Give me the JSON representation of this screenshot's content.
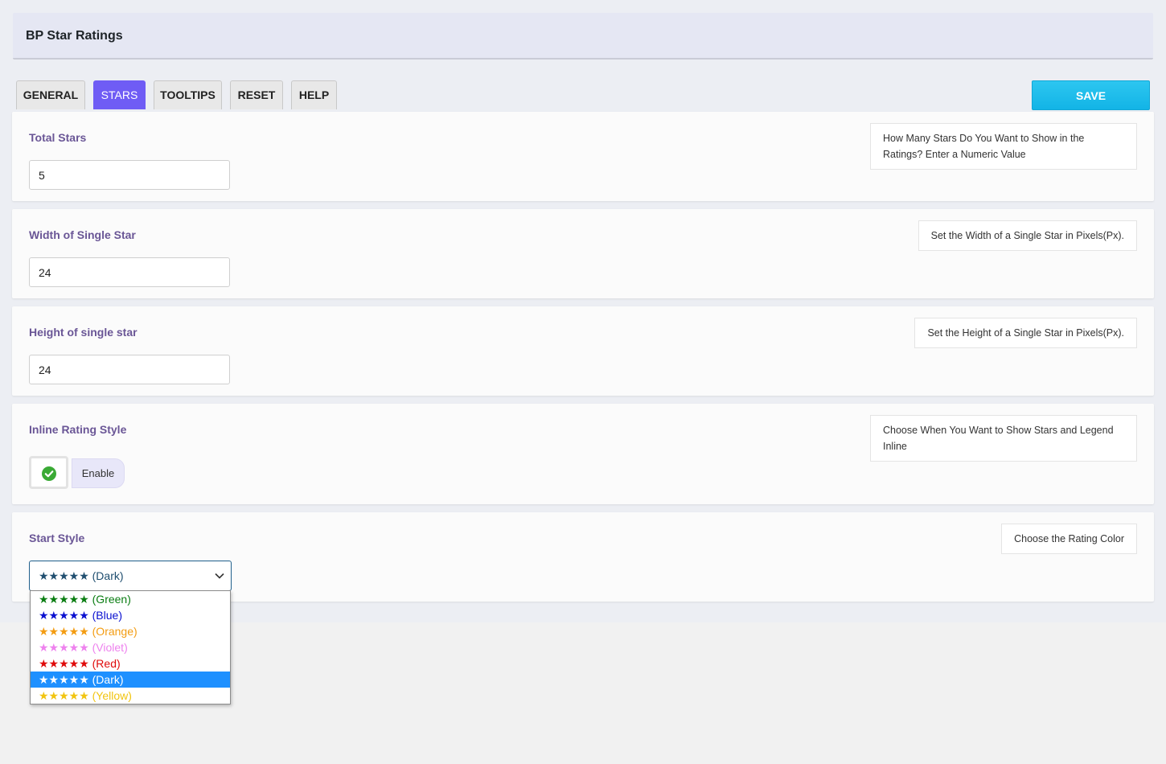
{
  "header": {
    "title": "BP Star Ratings"
  },
  "tabs": [
    {
      "label": "GENERAL"
    },
    {
      "label": "STARS"
    },
    {
      "label": "TOOLTIPS"
    },
    {
      "label": "RESET"
    },
    {
      "label": "HELP"
    }
  ],
  "active_tab": "STARS",
  "save_label": "SAVE",
  "fields": {
    "total_stars": {
      "label": "Total Stars",
      "value": "5",
      "help": "How Many Stars Do You Want to Show in the Ratings? Enter a Numeric Value"
    },
    "star_width": {
      "label": "Width of Single Star",
      "value": "24",
      "help": "Set the Width of a Single Star in Pixels(Px)."
    },
    "star_height": {
      "label": "Height of single star",
      "value": "24",
      "help": "Set the Height of a Single Star in Pixels(Px)."
    },
    "inline_style": {
      "label": "Inline Rating Style",
      "toggle_label": "Enable",
      "enabled": true,
      "help": "Choose When You Want to Show Stars and Legend Inline"
    },
    "star_style": {
      "label": "Start Style",
      "selected": "★★★★★ (Dark)",
      "help": "Choose the Rating Color",
      "options": [
        {
          "label": "★★★★★ (Green)",
          "color": "#0a7d12"
        },
        {
          "label": "★★★★★ (Blue)",
          "color": "#0a10d0"
        },
        {
          "label": "★★★★★ (Orange)",
          "color": "#f39c12"
        },
        {
          "label": "★★★★★ (Violet)",
          "color": "#ee82ee"
        },
        {
          "label": "★★★★★ (Red)",
          "color": "#e00b0b"
        },
        {
          "label": "★★★★★ (Dark)",
          "color": "#1f4e6f",
          "selected": true
        },
        {
          "label": "★★★★★ (Yellow)",
          "color": "#f1c40f"
        }
      ]
    }
  },
  "colors": {
    "accent": "#6f5cf5",
    "save": "#1ab8e8",
    "label": "#6a5696",
    "check": "#3aaa35"
  }
}
